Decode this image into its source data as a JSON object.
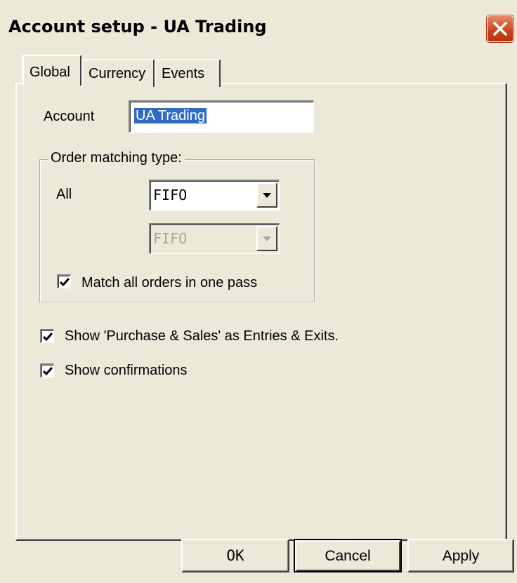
{
  "window": {
    "title": "Account setup - UA Trading"
  },
  "tabs": [
    {
      "label": "Global",
      "active": true
    },
    {
      "label": "Currency",
      "active": false
    },
    {
      "label": "Events",
      "active": false
    }
  ],
  "global": {
    "account_label": "Account",
    "account_value": "UA Trading",
    "order_group": {
      "legend": "Order matching type:",
      "all_label": "All",
      "select1_value": "FIFO",
      "select2_value": "FIFO",
      "match_all_label": "Match all orders in one pass",
      "match_all_checked": true
    },
    "show_purchase_label": "Show 'Purchase & Sales' as Entries & Exits.",
    "show_purchase_checked": true,
    "show_confirm_label": "Show confirmations",
    "show_confirm_checked": true
  },
  "buttons": {
    "ok": "OK",
    "cancel": "Cancel",
    "apply": "Apply"
  },
  "colors": {
    "selection": "#316ac5",
    "close_button": "#c9421d",
    "face": "#ece9d8"
  }
}
